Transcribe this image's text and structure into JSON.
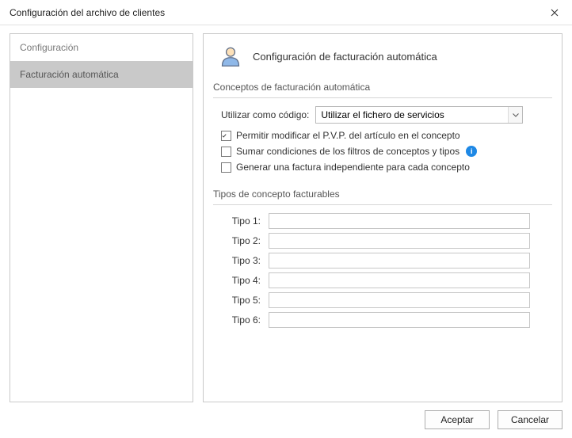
{
  "window": {
    "title": "Configuración del archivo de clientes"
  },
  "sidebar": {
    "items": [
      {
        "label": "Configuración"
      },
      {
        "label": "Facturación automática"
      }
    ],
    "selected_index": 1
  },
  "main": {
    "heading": "Configuración de facturación automática",
    "group1": {
      "title": "Conceptos de facturación automática",
      "use_as_code_label": "Utilizar como código:",
      "use_as_code_value": "Utilizar el fichero de servicios",
      "allow_modify_pvp": {
        "checked": true,
        "label": "Permitir modificar el P.V.P. del artículo en el concepto"
      },
      "sum_conditions": {
        "checked": false,
        "label": "Sumar condiciones de los filtros de conceptos y tipos"
      },
      "independent_invoice": {
        "checked": false,
        "label": "Generar una factura independiente para cada concepto"
      }
    },
    "group2": {
      "title": "Tipos de concepto facturables",
      "types": [
        {
          "label": "Tipo 1:",
          "value": ""
        },
        {
          "label": "Tipo 2:",
          "value": ""
        },
        {
          "label": "Tipo 3:",
          "value": ""
        },
        {
          "label": "Tipo 4:",
          "value": ""
        },
        {
          "label": "Tipo 5:",
          "value": ""
        },
        {
          "label": "Tipo 6:",
          "value": ""
        }
      ]
    }
  },
  "footer": {
    "accept": "Aceptar",
    "cancel": "Cancelar"
  },
  "icons": {
    "close": "close-icon",
    "user": "user-icon",
    "info": "i",
    "caret": "chevron-down-icon"
  }
}
